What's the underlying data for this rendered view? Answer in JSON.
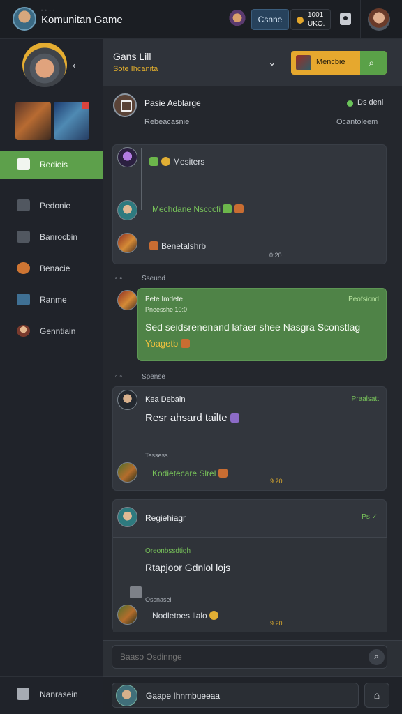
{
  "app": {
    "title": "Komunitan Game"
  },
  "topbar": {
    "mode_label": "Csnne",
    "coin_top": "1001",
    "coin_bottom": "UKO."
  },
  "sidebar": {
    "items": [
      {
        "label": "Redieis"
      },
      {
        "label": "Pedonie"
      },
      {
        "label": "Banrocbin"
      },
      {
        "label": "Benacie"
      },
      {
        "label": "Ranme"
      },
      {
        "label": "Genntiain"
      }
    ],
    "footer_label": "Nanrasein"
  },
  "chat": {
    "title": "Gans Lill",
    "subtitle": "Sote Ihcanita",
    "primary_button_label": "Mencbie",
    "pinned": {
      "title": "Pasie Aeblarge",
      "subtitle": "Rebeacasnie",
      "online_label": "Ds denl",
      "status_text": "Ocantoleem"
    },
    "messages": [
      {
        "line1": "Mesiters",
        "line2": "Mechdane Nscccfi",
        "line3": "Benetalshrb",
        "time": "0:20"
      },
      {
        "date": "Sseuod",
        "name": "Pete Imdete",
        "sub": "Pneesshe 10:0",
        "tag": "Peofsicnd",
        "body": "Sed seidsrenenand lafaer shee Nasgra Sconstlag",
        "body2": "Yoagetb"
      },
      {
        "date": "Spense",
        "name": "Kea Debain",
        "tag": "Praalsatt",
        "body": "Resr ahsard tailte",
        "sub": "Tessess",
        "green_line": "Kodietecare Slrel",
        "time": "9 20"
      },
      {
        "name": "Regiehiagr",
        "tag": "Ps",
        "inner_label": "Oreonbssdtigh",
        "inner_title": "Rtapjoor Gdnlol lojs",
        "inner_sub": "Ossnasei",
        "inner_line": "Nodletoes llalo",
        "time": "9 20"
      }
    ],
    "input_placeholder": "Baaso Osdinnge",
    "composer_text": "Gaape Ihnmbueeaa"
  },
  "colors": {
    "accent": "#5da04b",
    "warning": "#e6a82e",
    "background": "#24272d"
  }
}
